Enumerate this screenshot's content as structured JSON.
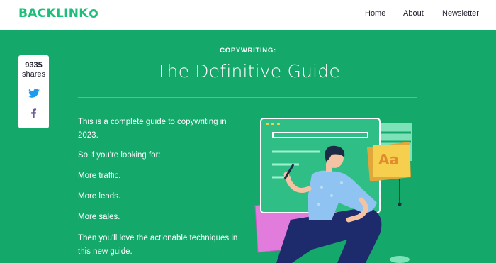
{
  "header": {
    "logo": "BACKLINK",
    "nav": [
      "Home",
      "About",
      "Newsletter"
    ]
  },
  "share": {
    "count": "9335",
    "label": "shares",
    "buttons": [
      "twitter-icon",
      "facebook-icon"
    ]
  },
  "article": {
    "kicker": "COPYWRITING:",
    "title": "The Definitive Guide",
    "paragraphs": [
      "This is a complete guide to copywriting in 2023.",
      "So if you're looking for:",
      "More traffic.",
      "More leads.",
      "More sales.",
      "Then you'll love the actionable techniques in this new guide."
    ]
  },
  "illustration": {
    "badge": "Aa"
  },
  "colors": {
    "brand": "#1cbf7a",
    "background": "#14a86b",
    "badge": "#f6cf4f",
    "accent_pink": "#e17bdc",
    "shirt": "#8fc3f2"
  }
}
